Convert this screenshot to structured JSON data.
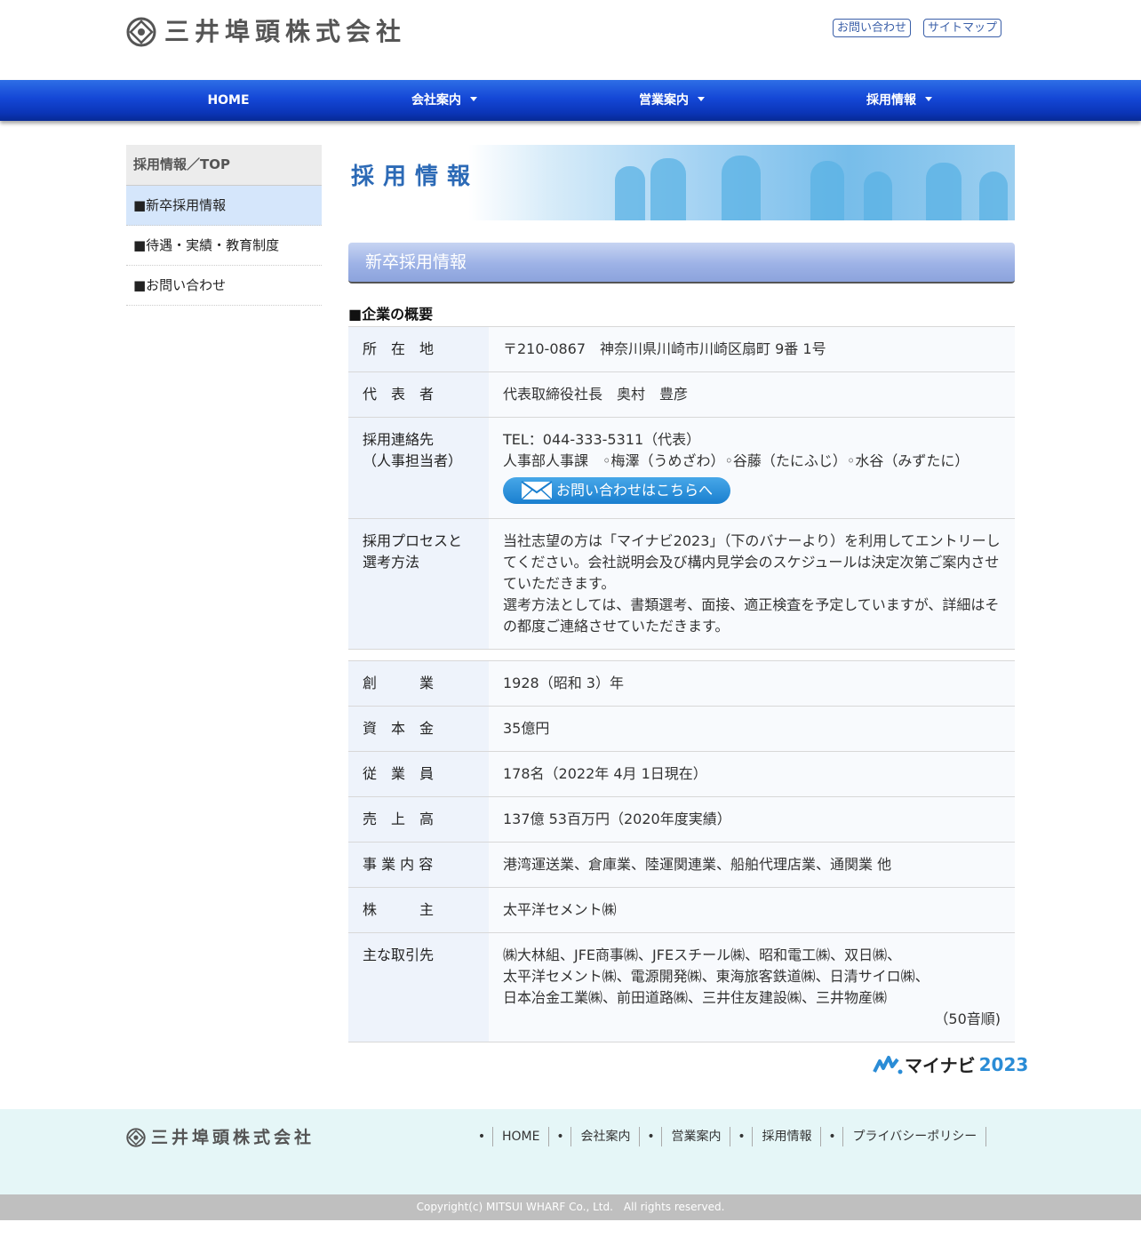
{
  "header": {
    "company_name": "三井埠頭株式会社",
    "links": [
      "お問い合わせ",
      "サイトマップ"
    ]
  },
  "nav": {
    "items": [
      "HOME",
      "会社案内",
      "営業案内",
      "採用情報"
    ]
  },
  "sidebar": {
    "head": "採用情報／TOP",
    "items": [
      "■新卒採用情報",
      "■待遇・実績・教育制度",
      "■お問い合わせ"
    ]
  },
  "main": {
    "banner_title": "採用情報",
    "section_title": "新卒採用情報",
    "overview_title": "■企業の概要",
    "table1": [
      {
        "k": "所　在　地",
        "v": "〒210-0867　神奈川県川崎市川崎区扇町 9番 1号"
      },
      {
        "k": "代　表　者",
        "v": "代表取締役社長　奥村　豊彦"
      }
    ],
    "contact": {
      "k1": "採用連絡先",
      "k2": "（人事担当者）",
      "tel": "TEL：044-333-5311（代表）",
      "persons": "人事部人事課　◦梅澤（うめざわ）◦谷藤（たにふじ）◦水谷（みずたに）",
      "button": "お問い合わせはこちらへ"
    },
    "process": {
      "k1": "採用プロセスと",
      "k2": "選考方法",
      "v1": "当社志望の方は「マイナビ2023」（下のバナーより）を利用してエントリーしてください。会社説明会及び構内見学会のスケジュールは決定次第ご案内させていただきます。",
      "v2": "選考方法としては、書類選考、面接、適正検査を予定していますが、詳細はその都度ご連絡させていただきます。"
    },
    "table2": [
      {
        "k": "創　　　業",
        "v": "1928（昭和 3）年"
      },
      {
        "k": "資　本　金",
        "v": "35億円"
      },
      {
        "k": "従　業　員",
        "v": "178名（2022年 4月 1日現在）"
      },
      {
        "k": "売　上　高",
        "v": "137億 53百万円（2020年度実績）"
      },
      {
        "k": "事 業 内 容",
        "v": "港湾運送業、倉庫業、陸運関連業、船舶代理店業、通関業 他"
      },
      {
        "k": "株　　　主",
        "v": "太平洋セメント㈱"
      }
    ],
    "partners": {
      "k": "主な取引先",
      "line1": "㈱大林組、JFE商事㈱、JFEスチール㈱、昭和電工㈱、双日㈱、",
      "line2": "太平洋セメント㈱、電源開発㈱、東海旅客鉄道㈱、日清サイロ㈱、",
      "line3": "日本冶金工業㈱、前田道路㈱、三井住友建設㈱、三井物産㈱",
      "note": "（50音順)"
    },
    "mynavi": {
      "name": "マイナビ",
      "year": "2023"
    }
  },
  "footer": {
    "company_name": "三井埠頭株式会社",
    "links": [
      "HOME",
      "会社案内",
      "営業案内",
      "採用情報",
      "プライバシーポリシー"
    ],
    "copyright": "Copyright(c) MITSUI WHARF Co., Ltd.　All rights reserved."
  },
  "colors": {
    "nav": "#1447d6",
    "accent": "#3a5fa8",
    "sidebar_active": "#d5e6fb",
    "footer": "#e5f6f7"
  }
}
